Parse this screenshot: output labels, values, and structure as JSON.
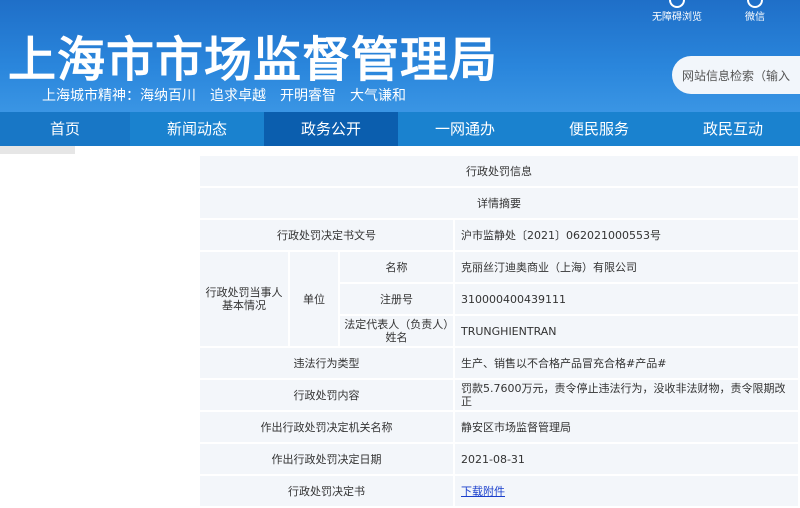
{
  "header": {
    "title": "上海市市场监督管理局",
    "slogan": "上海城市精神：海纳百川　追求卓越　开明睿智　大气谦和",
    "accessibility": "无障碍浏览",
    "wechat": "微信",
    "search_placeholder": "网站信息检索（输入"
  },
  "nav": [
    "首页",
    "新闻动态",
    "政务公开",
    "一网通办",
    "便民服务",
    "政民互动"
  ],
  "table": {
    "title": "行政处罚信息",
    "summary": "详情摘要",
    "doc_no_label": "行政处罚决定书文号",
    "doc_no": "沪市监静处〔2021〕062021000553号",
    "party_label": "行政处罚当事人基本情况",
    "unit_label": "单位",
    "name_label": "名称",
    "name": "克丽丝汀迪奥商业（上海）有限公司",
    "reg_label": "注册号",
    "reg": "310000400439111",
    "rep_label": "法定代表人（负责人）姓名",
    "rep": "TRUNGHIENTRAN",
    "type_label": "违法行为类型",
    "type": "生产、销售以不合格产品冒充合格#产品#",
    "content_label": "行政处罚内容",
    "content": "罚款5.7600万元，责令停止违法行为，没收非法财物，责令限期改正",
    "org_label": "作出行政处罚决定机关名称",
    "org": "静安区市场监督管理局",
    "date_label": "作出行政处罚决定日期",
    "date": "2021-08-31",
    "file_label": "行政处罚决定书",
    "file_link": "下载附件"
  }
}
